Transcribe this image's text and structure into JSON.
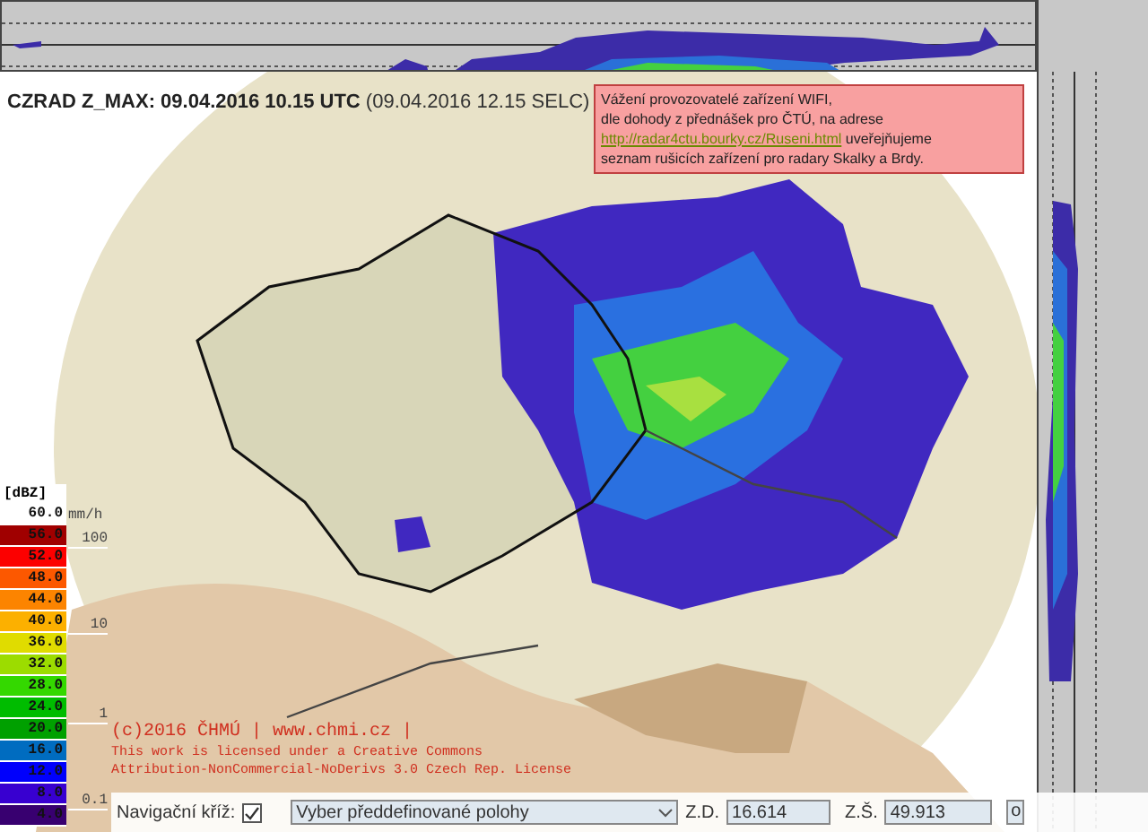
{
  "title": {
    "product": "CZRAD Z_MAX: 09.04.2016 10.15 UTC",
    "local_time": "(09.04.2016 12.15 SELC)"
  },
  "notice": {
    "lines": [
      "Vážení provozovatelé zařízení WIFI,",
      "dle dohody z přednášek pro ČTÚ, na adrese"
    ],
    "link": "http://radar4ctu.bourky.cz/Ruseni.html",
    "after_link": "uveřejňujeme",
    "last_line": "seznam rušicích zařízení pro radary Skalky a Brdy."
  },
  "legend": {
    "unit": "[dBZ]",
    "items": [
      {
        "label": "60.0",
        "color": "#ffffff"
      },
      {
        "label": "56.0",
        "color": "#a00000"
      },
      {
        "label": "52.0",
        "color": "#fc0000"
      },
      {
        "label": "48.0",
        "color": "#fc5800"
      },
      {
        "label": "44.0",
        "color": "#fc8400"
      },
      {
        "label": "40.0",
        "color": "#fcb000"
      },
      {
        "label": "36.0",
        "color": "#e0dc00"
      },
      {
        "label": "32.0",
        "color": "#9cdc00"
      },
      {
        "label": "28.0",
        "color": "#34d800"
      },
      {
        "label": "24.0",
        "color": "#00bc00"
      },
      {
        "label": "20.0",
        "color": "#00a000"
      },
      {
        "label": "16.0",
        "color": "#006cc0"
      },
      {
        "label": "12.0",
        "color": "#0000fc"
      },
      {
        "label": "8.0",
        "color": "#3800d0"
      },
      {
        "label": "4.0",
        "color": "#380070"
      }
    ]
  },
  "rain_scale": {
    "unit": "mm/h",
    "ticks": [
      "100",
      "10",
      "1",
      "0.1"
    ]
  },
  "copyright": {
    "line_1": "(c)2016 ČHMÚ | www.chmi.cz |",
    "line_2": "This work is licensed under a Creative Commons",
    "line_3": "Attribution-NonCommercial-NoDerivs 3.0 Czech Rep. License"
  },
  "toolbar": {
    "cross_label": "Navigační kříž:",
    "cross_checked": true,
    "preset": "Vyber předdefinované polohy",
    "lon_label": "Z.D.",
    "lon_value": "16.614",
    "lat_label": "Z.Š.",
    "lat_value": "49.913",
    "button": "o"
  }
}
